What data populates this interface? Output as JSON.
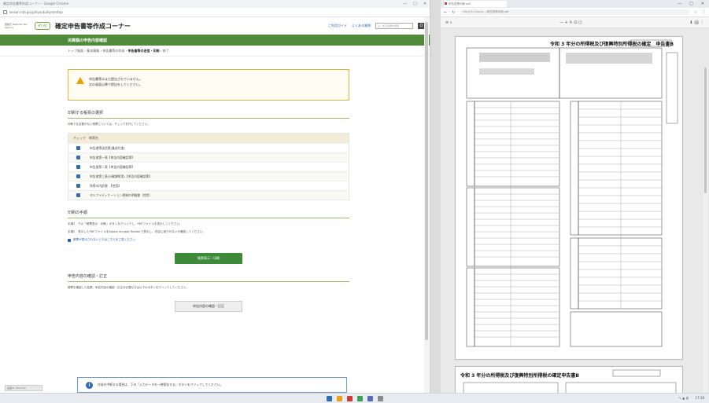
{
  "left_window": {
    "title": "確定申告書等作成コーナー - Google Chrome",
    "url": "keisan.nta.go.jp/kyoutu/ky/sm/top",
    "controls": {
      "minimize": "—",
      "maximize": "□",
      "close": "✕"
    }
  },
  "site_header": {
    "logo_text": "国税庁 National Tax Agency",
    "badge": "ぜいむ",
    "title": "確定申告書等作成コーナー",
    "link_usage": "ご利用ガイド",
    "link_faq": "よくある質問",
    "search_placeholder": "よくある質問を検索",
    "search_btn": "Q"
  },
  "section_bar": "決算額の申告内容確認",
  "breadcrumb": {
    "items": [
      "トップ画面",
      "基本情報",
      "申告書等の作成",
      "申告書等の送信・印刷",
      "終了"
    ],
    "separator": "›"
  },
  "warning": {
    "line1": "申告書等はまだ提出されていません。",
    "line2": "次の画面以降で提出をしてください。"
  },
  "print_select": {
    "title": "印刷する帳票の選択",
    "desc": "印刷する必要がない帳票については、チェックを外してください。",
    "table_head": "チェック　帳票名",
    "rows": [
      "申告書等送信票(兼送付書)",
      "申告書第一表【申告内容確認票】",
      "申告書第二表【申告内容確認票】",
      "申告書第三表(分離課税用)【申告内容確認票】",
      "所得の内訳書　【控用】",
      "セルフメディケーション税制の明細書（控用）"
    ]
  },
  "procedure": {
    "title": "印刷の手順",
    "step1": "手順1　下の「帳票表示・印刷」ボタンをクリックし、PDFファイルを表示してください。",
    "step2": "手順2　表示したPDFファイルをAdobe Acrobat Readerで表示し、内容に誤りがないか確認してください。",
    "link": "帳票が表示されないときはこちらをご覧ください",
    "button": "帳票表示・印刷"
  },
  "review": {
    "title": "申告内容の確認・訂正",
    "desc": "帳票を確認した結果、申告内容の確認・訂正が必要な方は以下のボタンをクリックしてください。",
    "button": "申告内容の確認・訂正"
  },
  "info_box": {
    "icon": "i",
    "text": "作成を中断する場合は、下の「入力データを一時保存する」ボタンをクリックしてください。"
  },
  "page_id": "画面ID: SM-D-00",
  "right_window": {
    "tab_title": "申告書等印刷.pdf",
    "url": "file:///C:/Users/.../申告書等印刷.pdf",
    "toolbar_left": "≡  ⌕",
    "toolbar_mid": "—  +  ↻  ⊡  ◫",
    "toolbar_right": "⬇  🖨  ⋮"
  },
  "pdf": {
    "page1_title": "令和 3 年分の所得税及び復興特別所得税の確定　申告書B",
    "page2_title": "令和 3 年分の所得税及び復興特別所得税の確定申告書B"
  },
  "tray": {
    "ime": "へ ▲ あ",
    "time": "17:38"
  }
}
